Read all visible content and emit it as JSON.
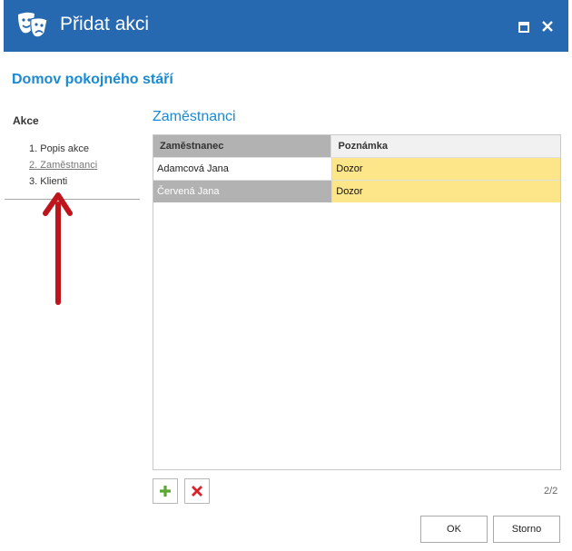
{
  "window": {
    "title": "Přidat akci",
    "icon": "theater-masks-icon",
    "controls": [
      "maximize-icon",
      "close-icon"
    ]
  },
  "org_title": "Domov pokojného stáří",
  "sidebar": {
    "heading": "Akce",
    "steps": [
      {
        "label": "1. Popis akce",
        "active": false
      },
      {
        "label": "2. Zaměstnanci",
        "active": true
      },
      {
        "label": "3. Klienti",
        "active": false
      }
    ]
  },
  "section_title": "Zaměstnanci",
  "grid": {
    "columns": [
      "Zaměstnanec",
      "Poznámka"
    ],
    "rows": [
      {
        "employee": "Adamcová Jana",
        "note": "Dozor",
        "selected": false
      },
      {
        "employee": "Červená Jana",
        "note": "Dozor",
        "selected": true
      }
    ]
  },
  "toolbar": {
    "add_icon": "plus-icon",
    "remove_icon": "x-icon"
  },
  "pager": "2/2",
  "buttons": {
    "ok": "OK",
    "cancel": "Storno"
  },
  "colors": {
    "titlebar": "#2669b0",
    "accent": "#1a8ad4",
    "note_cell": "#fde68a",
    "selected_row": "#b2b2b2",
    "arrow": "#c0141c"
  }
}
